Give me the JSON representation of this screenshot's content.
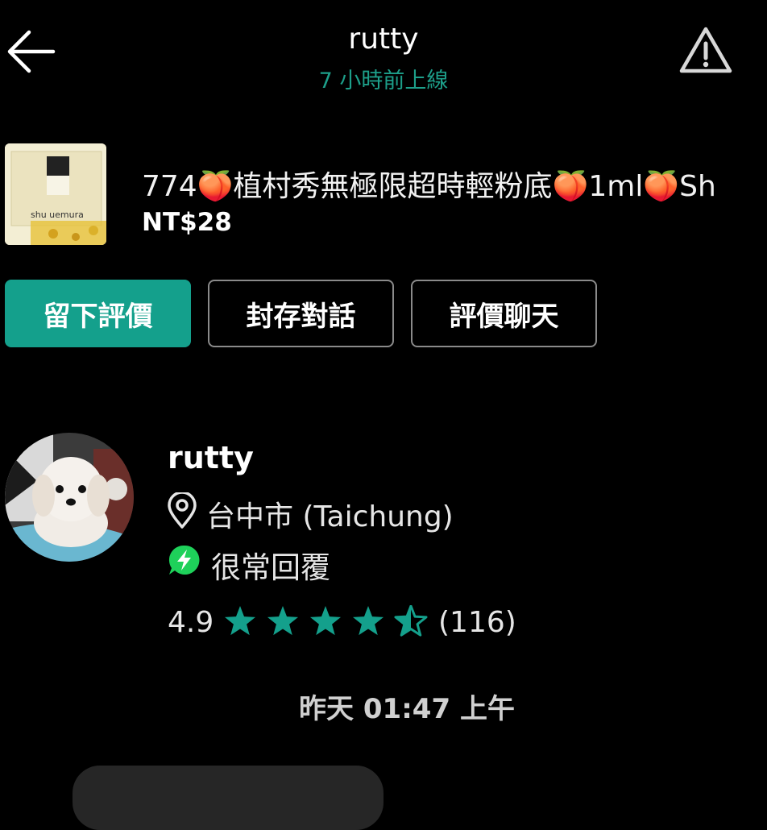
{
  "header": {
    "title": "rutty",
    "status": "7 小時前上線",
    "back_icon": "back-arrow-icon",
    "report_icon": "warning-icon"
  },
  "product": {
    "title": "774🍑植村秀無極限超時輕粉底🍑1ml🍑Sh",
    "price": "NT$28",
    "thumb_brand": "shu uemura"
  },
  "actions": {
    "leave_review": "留下評價",
    "archive_chat": "封存對話",
    "review_chat": "評價聊天"
  },
  "seller": {
    "name": "rutty",
    "location": "台中市 (Taichung)",
    "response": "很常回覆",
    "rating": "4.9",
    "stars": 4.5,
    "review_count": "(116)"
  },
  "chat": {
    "timestamp": "昨天 01:47 上午"
  },
  "colors": {
    "accent": "#14a08c",
    "online": "#1d9f8a",
    "responsive": "#1ed15a",
    "background": "#000000"
  }
}
